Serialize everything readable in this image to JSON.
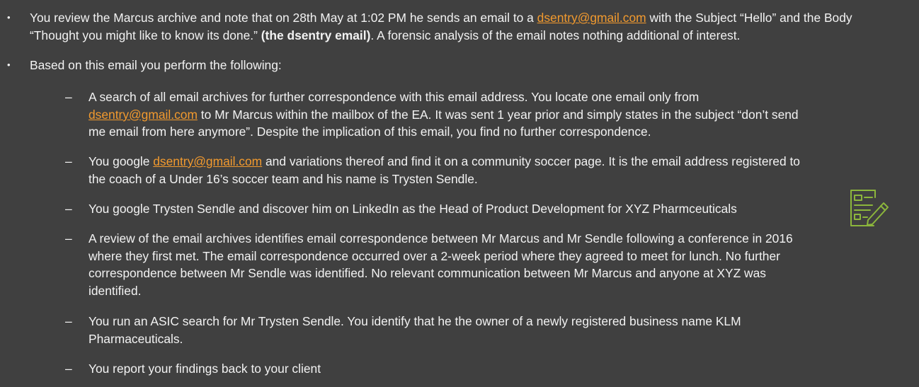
{
  "bullet_glyph": "•",
  "dash_glyph": "–",
  "colors": {
    "background": "#404040",
    "text": "#f2f2f2",
    "link": "#f29a2e",
    "icon": "#8cb63c"
  },
  "icon": "document-edit-icon",
  "bullets": [
    {
      "parts": [
        {
          "text": "You review the Marcus archive and note that on 28th May at 1:02 PM he sends an email to a ",
          "style": "plain"
        },
        {
          "text": "dsentry@gmail.com",
          "style": "link"
        },
        {
          "text": " with the Subject “Hello” and the Body “Thought you might like to know its done.” ",
          "style": "plain"
        },
        {
          "text": "(the dsentry email)",
          "style": "bold"
        },
        {
          "text": ". A forensic analysis of the email notes nothing additional of interest.",
          "style": "plain"
        }
      ]
    },
    {
      "parts": [
        {
          "text": "Based on this email you perform the following:",
          "style": "plain"
        }
      ]
    }
  ],
  "sub_items": [
    {
      "parts": [
        {
          "text": "A search of all email archives for further correspondence with this email address. You locate one email only from ",
          "style": "plain"
        },
        {
          "text": "dsentry@gmail.com",
          "style": "link"
        },
        {
          "text": " to Mr Marcus within the mailbox of the EA. It was sent 1 year prior and simply states in the subject “don’t send me email from here anymore”. Despite the implication of this email, you find no further correspondence.",
          "style": "plain"
        }
      ]
    },
    {
      "parts": [
        {
          "text": "You google ",
          "style": "plain"
        },
        {
          "text": "dsentry@gmail.com",
          "style": "link"
        },
        {
          "text": " and variations thereof and find it on a community soccer page. It is the email address registered to the coach of a Under 16’s soccer team and his name is Trysten Sendle.",
          "style": "plain"
        }
      ]
    },
    {
      "parts": [
        {
          "text": "You google Trysten Sendle and discover him on LinkedIn as the Head of Product Development for XYZ Pharmceuticals",
          "style": "plain"
        }
      ]
    },
    {
      "parts": [
        {
          "text": "A review of the email archives identifies email correspondence between Mr Marcus and Mr Sendle following a conference in 2016 where they first met. The email correspondence occurred over a 2-week period where they agreed to meet for lunch. No further correspondence between Mr Sendle was identified. No relevant communication between Mr Marcus and anyone at XYZ was identified.",
          "style": "plain"
        }
      ]
    },
    {
      "parts": [
        {
          "text": "You run an ASIC search for Mr Trysten Sendle. You identify that he the owner of a newly registered business name KLM Pharmaceuticals.",
          "style": "plain"
        }
      ]
    },
    {
      "parts": [
        {
          "text": "You report your findings back to your client",
          "style": "plain"
        }
      ]
    }
  ]
}
